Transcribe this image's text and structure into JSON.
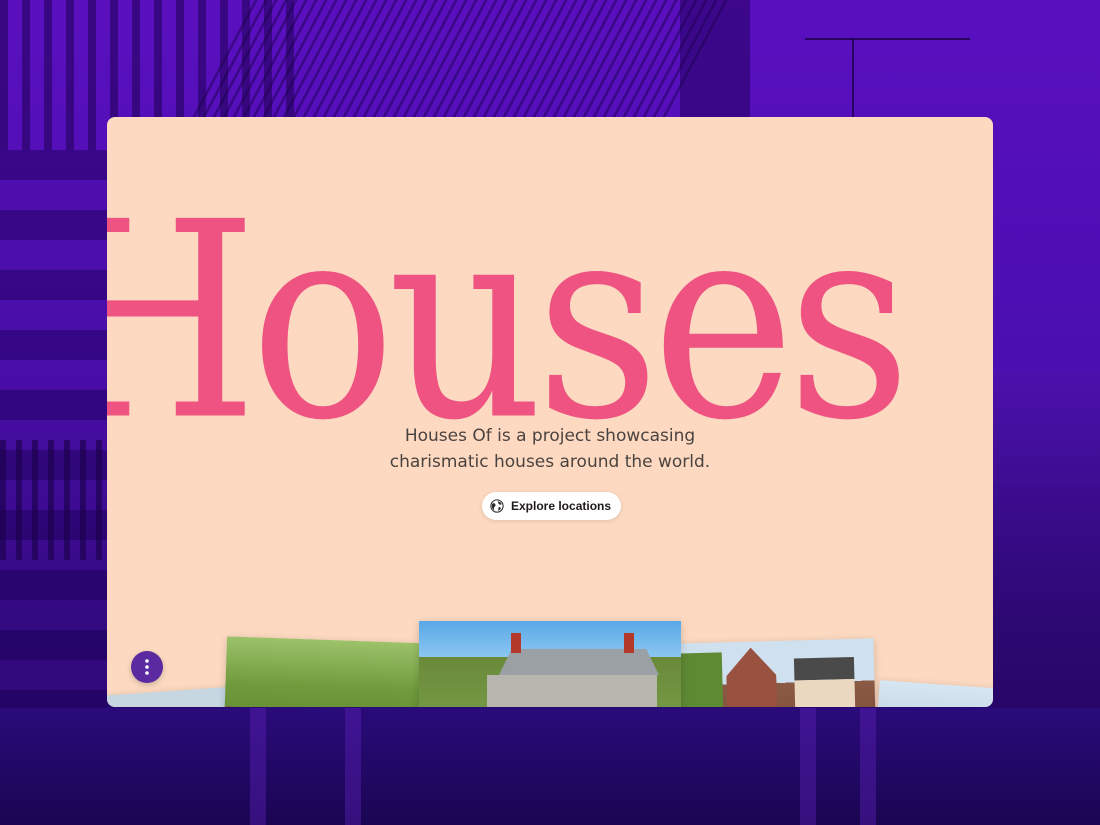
{
  "hero": {
    "title": "Houses",
    "tagline_line1": "Houses Of is a project showcasing",
    "tagline_line2": "charismatic houses around the world.",
    "explore_label": "Explore locations"
  },
  "icons": {
    "explore": "globe-icon",
    "menu": "more-vertical-icon"
  },
  "colors": {
    "background": "#4a0fb0",
    "card": "#fcd9c0",
    "title": "#ee5381",
    "menu_button": "#5b2aa0"
  }
}
